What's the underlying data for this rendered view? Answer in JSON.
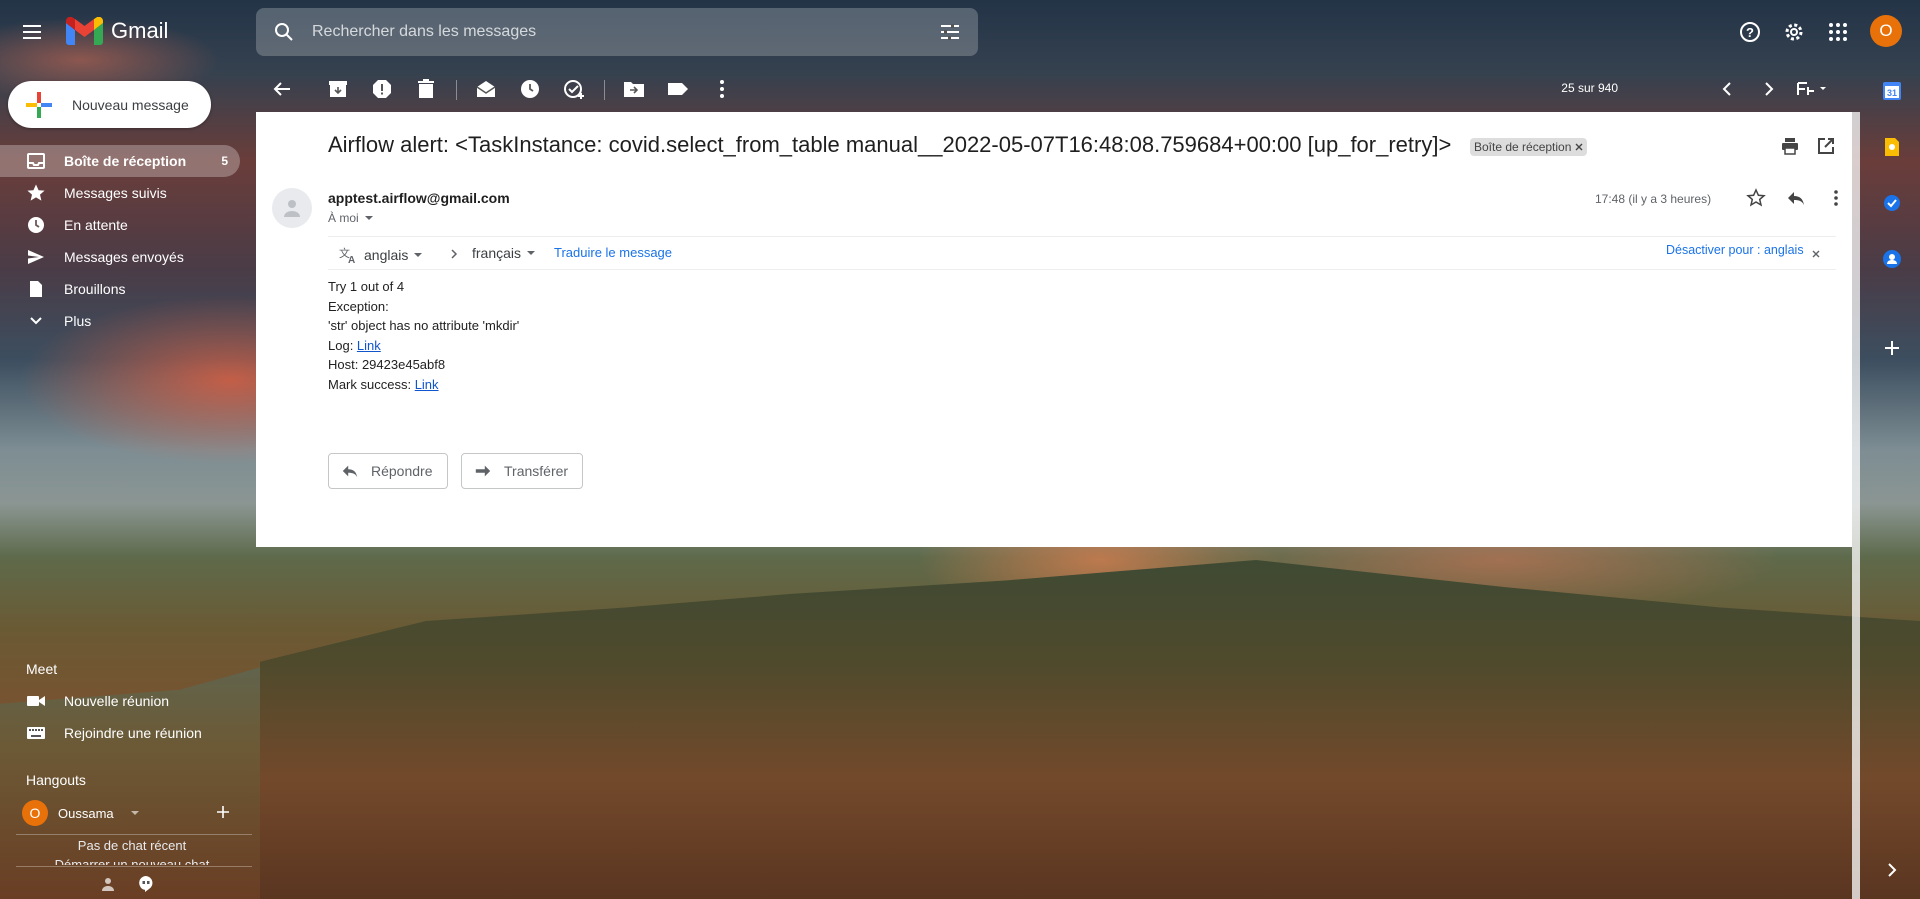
{
  "app": {
    "name": "Gmail"
  },
  "search": {
    "placeholder": "Rechercher dans les messages"
  },
  "user": {
    "initial": "O"
  },
  "compose": {
    "label": "Nouveau message"
  },
  "nav": {
    "items": [
      {
        "label": "Boîte de réception",
        "count": "5",
        "icon": "inbox-icon"
      },
      {
        "label": "Messages suivis",
        "icon": "star-icon"
      },
      {
        "label": "En attente",
        "icon": "clock-icon"
      },
      {
        "label": "Messages envoyés",
        "icon": "send-icon"
      },
      {
        "label": "Brouillons",
        "icon": "draft-icon"
      },
      {
        "label": "Plus",
        "icon": "chevron-down-icon"
      }
    ]
  },
  "meet": {
    "title": "Meet",
    "new_meeting": "Nouvelle réunion",
    "join_meeting": "Rejoindre une réunion"
  },
  "hangouts": {
    "title": "Hangouts",
    "user_name": "Oussama",
    "user_initial": "O",
    "no_chat": "Pas de chat récent",
    "start_chat": "Démarrer un nouveau chat"
  },
  "toolbar": {
    "pager": "25 sur 940"
  },
  "email": {
    "subject": "Airflow alert: <TaskInstance: covid.select_from_table manual__2022-05-07T16:48:08.759684+00:00 [up_for_retry]>",
    "label_chip": "Boîte de réception",
    "sender": "apptest.airflow@gmail.com",
    "to": "À moi",
    "time": "17:48 (il y a 3 heures)",
    "translate": {
      "from_lang": "anglais",
      "to_lang": "français",
      "translate_link": "Traduire le message",
      "disable": "Désactiver pour : anglais"
    },
    "body": {
      "line1": "Try 1 out of 4",
      "line2": "Exception:",
      "line3": "'str' object has no attribute 'mkdir'",
      "log_prefix": "Log: ",
      "log_link": "Link",
      "host": "Host: 29423e45abf8",
      "mark_prefix": "Mark success: ",
      "mark_link": "Link"
    },
    "reply_label": "Répondre",
    "forward_label": "Transférer"
  },
  "colors": {
    "accent": "#1a73e8",
    "avatar": "#e8710a",
    "link": "#1155cc"
  }
}
